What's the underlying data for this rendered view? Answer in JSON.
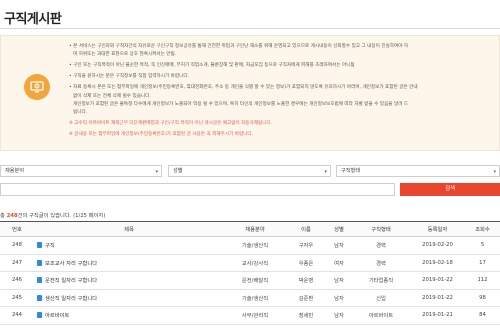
{
  "page": {
    "title": "구직게시판"
  },
  "notice": {
    "lines": [
      {
        "text": "• 본 서비스는 구인자와 구직자간의 자유로운 구인구직 정보공유를 통해 건전한 취업과 구인난 해소를 위해 운영되고 있으므로 게시내용이 신뢰할수 있고 그 내용이 진실하여야 하",
        "cls": ""
      },
      {
        "text": "며 허위또는 과대한 표현으로 상호 현혹시켜서는 안됨.",
        "cls": "indent"
      },
      {
        "text": "• 구인 또는 구직목적이 아닌 불순한 목적, 즉 인신매매, 무허가 직업소개, 불륜장해 및 판매, 자금모집 등으로 구직자에게 피해를 초래하여서는 아니됨",
        "cls": "gap"
      },
      {
        "text": "• 구직을 원하시는 분은 구직정보를 직접 입력하시기 바랍니다.",
        "cls": "gap"
      },
      {
        "text": "• 자료 등록시 본은 또는 첨부파일에 개인정보(주민등록번호, 휴대전화번호, 주소 등 개인을 식별 할 수 있는 정보)가 포함되지 않도록 유의하시기 바라며, 개인정보가 포함된 글은 안내",
        "cls": "gap"
      },
      {
        "text": "없이 삭제 또는 전체 삭제 될수 있습니다.",
        "cls": "indent"
      },
      {
        "text": "개인정보가 포함된 글은 불특정 다수에게 개인정보가 노출되어 악용 될 수 있으며, 특히 타인의 개인정보를 노출한 경우에는 개인정보보호법에 따라 처벌 받을 수 있음을 알려 드",
        "cls": "indent"
      },
      {
        "text": "립니다.",
        "cls": "indent"
      },
      {
        "text": "※ 고수익 아르바이트 재택근무 다단계판매업과 구인/구직 목적이 아닌 게시글은 예고없이 자동삭제됩니다.",
        "cls": "red gap"
      },
      {
        "text": "※ 글내용 또는 첨부파일에 개인정보(주민등록번호)가 포함된 글 사용은 꼭 피해주시기 바랍니다.",
        "cls": "red gap"
      }
    ]
  },
  "filters": {
    "job_field": "채용분야",
    "gender": "성별",
    "job_type": "구직형태"
  },
  "search": {
    "button_label": "검색"
  },
  "count": {
    "prefix": "총 ",
    "total": "248",
    "middle": "건의 구직글이 있습니다. (1/25 페이지)"
  },
  "table": {
    "headers": [
      "번호",
      "제목",
      "채용분야",
      "이름",
      "성별",
      "구직형태",
      "등록일자",
      "조회수"
    ],
    "rows": [
      {
        "no": "248",
        "title": "구직",
        "field": "기술/생산직",
        "name": "구자우",
        "gender": "남자",
        "type": "경력",
        "date": "2019-02-20",
        "views": "5"
      },
      {
        "no": "247",
        "title": "보조교사 자리 구합니다",
        "field": "교사/강사직",
        "name": "우종은",
        "gender": "여자",
        "type": "경력",
        "date": "2019-02-18",
        "views": "17"
      },
      {
        "no": "246",
        "title": "운전직 일자리 구합니다",
        "field": "운전/배달직",
        "name": "박운영",
        "gender": "남자",
        "type": "기타업종직",
        "date": "2019-01-22",
        "views": "112"
      },
      {
        "no": "245",
        "title": "생산직 일자리 구합니다",
        "field": "기술/생산직",
        "name": "김준환",
        "gender": "남자",
        "type": "신입",
        "date": "2019-01-22",
        "views": "98"
      },
      {
        "no": "244",
        "title": "아르바이트",
        "field": "사무/관리직",
        "name": "장세민",
        "gender": "남자",
        "type": "아르바이트",
        "date": "2019-01-21",
        "views": "84"
      }
    ]
  }
}
